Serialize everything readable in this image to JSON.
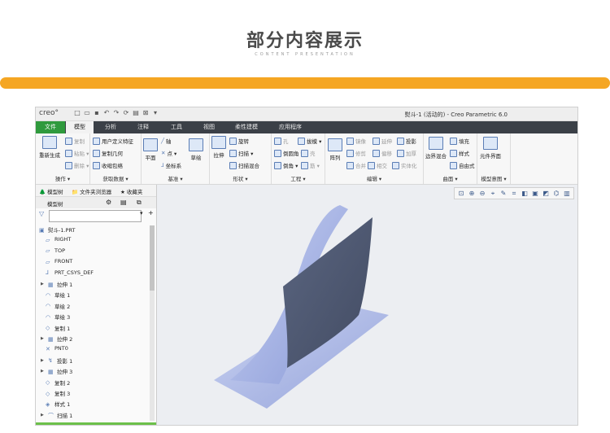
{
  "slide": {
    "title": "部分内容展示",
    "subtitle": "CONTENT PRESENTATION"
  },
  "app": {
    "logo": "creo°",
    "window_title": "熨斗-1 (活动的) - Creo Parametric 6.0",
    "tabs": [
      "文件",
      "模型",
      "分析",
      "注释",
      "工具",
      "视图",
      "柔性建模",
      "应用程序"
    ],
    "active_tab": "模型",
    "groups": {
      "operation": {
        "label": "操作 ▾",
        "regenerate": "重新生成",
        "copy": "复制",
        "paste": "粘贴 ▾",
        "delete": "删除 ▾"
      },
      "get_data": {
        "label": "获取数据 ▾",
        "udf": "用户定义特征",
        "copy_geom": "复制几何",
        "shrinkwrap": "收缩包络"
      },
      "datum": {
        "label": "基准 ▾",
        "plane": "平面",
        "axis": "轴",
        "point": "点 ▾",
        "csys": "坐标系",
        "sketch": "草绘"
      },
      "shape": {
        "label": "形状 ▾",
        "extrude": "拉伸",
        "revolve": "旋转",
        "sweep": "扫描 ▾",
        "swept_blend": "扫描混合"
      },
      "engineering": {
        "label": "工程 ▾",
        "hole": "孔",
        "draft": "拔模 ▾",
        "round": "倒圆角 ▾",
        "shell": "壳",
        "chamfer": "倒角 ▾",
        "rib": "筋 ▾"
      },
      "editing": {
        "label": "编辑 ▾",
        "pattern": "阵列",
        "mirror": "镜像",
        "extend": "延伸",
        "project": "投影",
        "trim": "修剪",
        "offset": "偏移",
        "thicken": "加厚",
        "merge": "合并",
        "intersect": "相交",
        "solidify": "实体化"
      },
      "surfaces": {
        "label": "曲面 ▾",
        "boundary_blend": "边界混合",
        "fill": "填充",
        "style": "样式",
        "freestyle": "自由式"
      },
      "intent": {
        "label": "模型意图 ▾",
        "component_interface": "元件界面"
      }
    },
    "left_panel": {
      "tabs": [
        "模型树",
        "文件夹浏览器",
        "收藏夹"
      ],
      "header": "模型树",
      "filter_placeholder": "",
      "tree": [
        {
          "label": "熨斗-1.PRT",
          "icon": "part-icon",
          "expand": false
        },
        {
          "label": "RIGHT",
          "icon": "datum-plane-icon",
          "expand": false
        },
        {
          "label": "TOP",
          "icon": "datum-plane-icon",
          "expand": false
        },
        {
          "label": "FRONT",
          "icon": "datum-plane-icon",
          "expand": false
        },
        {
          "label": "PRT_CSYS_DEF",
          "icon": "csys-icon",
          "expand": false
        },
        {
          "label": "拉伸 1",
          "icon": "extrude-icon",
          "expand": true
        },
        {
          "label": "草绘 1",
          "icon": "sketch-icon",
          "expand": false
        },
        {
          "label": "草绘 2",
          "icon": "sketch-icon",
          "expand": false
        },
        {
          "label": "草绘 3",
          "icon": "sketch-icon",
          "expand": false
        },
        {
          "label": "复制 1",
          "icon": "copy-surface-icon",
          "expand": false
        },
        {
          "label": "拉伸 2",
          "icon": "extrude-icon",
          "expand": true
        },
        {
          "label": "PNT0",
          "icon": "datum-point-icon",
          "expand": false
        },
        {
          "label": "投影 1",
          "icon": "project-icon",
          "expand": true
        },
        {
          "label": "拉伸 3",
          "icon": "extrude-icon",
          "expand": true
        },
        {
          "label": "复制 2",
          "icon": "copy-surface-icon",
          "expand": false
        },
        {
          "label": "复制 3",
          "icon": "copy-surface-icon",
          "expand": false
        },
        {
          "label": "样式 1",
          "icon": "style-icon",
          "expand": false
        },
        {
          "label": "扫描 1",
          "icon": "sweep-icon",
          "expand": true
        }
      ]
    },
    "colors": {
      "accent_orange": "#f5a623",
      "file_tab_green": "#2f9a3d",
      "tab_bar_dark": "#3b4047",
      "surface_blue": "#a9b7e6",
      "surface_slate": "#4f5a72"
    }
  }
}
